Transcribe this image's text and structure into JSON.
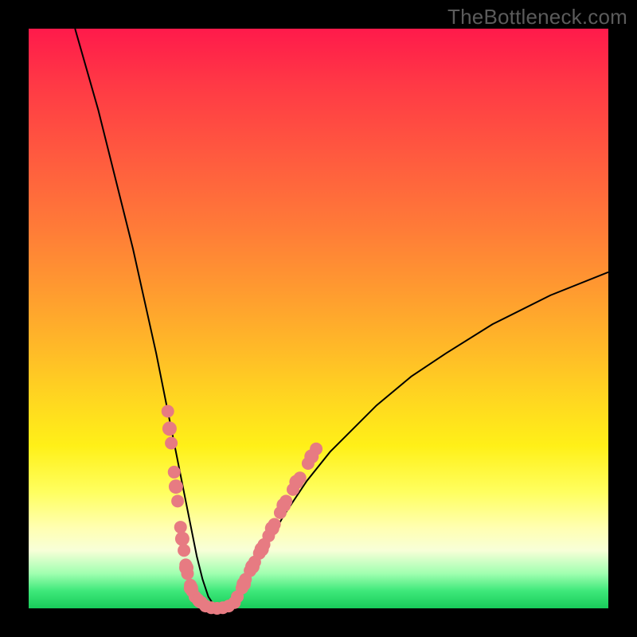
{
  "watermark": "TheBottleneck.com",
  "chart_data": {
    "type": "line",
    "title": "",
    "xlabel": "",
    "ylabel": "",
    "xlim": [
      0,
      100
    ],
    "ylim": [
      0,
      100
    ],
    "curve": {
      "x": [
        8,
        10,
        12,
        14,
        16,
        18,
        20,
        22,
        24,
        25,
        26,
        27,
        28,
        29,
        30,
        31,
        32,
        33,
        34,
        36,
        38,
        40,
        44,
        48,
        52,
        56,
        60,
        66,
        72,
        80,
        90,
        100
      ],
      "y": [
        100,
        93,
        86,
        78,
        70,
        62,
        53,
        44,
        34,
        29,
        24,
        19,
        14,
        9,
        5,
        2,
        0.5,
        0,
        0.5,
        2,
        5,
        9,
        16,
        22,
        27,
        31,
        35,
        40,
        44,
        49,
        54,
        58
      ]
    },
    "markers_left": {
      "x": [
        24.0,
        24.6,
        25.1,
        25.7,
        26.2,
        26.8,
        27.1,
        27.4,
        27.9,
        28.2,
        28.7,
        29.2,
        29.4,
        29.8
      ],
      "y": [
        34.0,
        28.5,
        23.5,
        18.5,
        14.0,
        10.0,
        7.5,
        6.0,
        4.0,
        3.0,
        2.0,
        1.5,
        1.2,
        1.0
      ]
    },
    "markers_bottom": {
      "x": [
        30.5,
        31.5,
        32.5,
        33.5,
        34.5,
        35.5
      ],
      "y": [
        0.4,
        0.1,
        0.0,
        0.1,
        0.4,
        1.0
      ]
    },
    "markers_right": {
      "x": [
        36.0,
        36.8,
        37.4,
        38.2,
        39.0,
        39.8,
        40.6,
        41.4,
        42.4,
        43.4,
        44.4,
        45.6,
        46.8,
        48.2,
        49.6
      ],
      "y": [
        2.0,
        3.5,
        5.0,
        6.5,
        8.0,
        9.5,
        11.0,
        12.5,
        14.5,
        16.5,
        18.5,
        20.5,
        22.5,
        25.0,
        27.5
      ]
    },
    "marker_color": "#e77b82",
    "curve_color": "#000000"
  }
}
